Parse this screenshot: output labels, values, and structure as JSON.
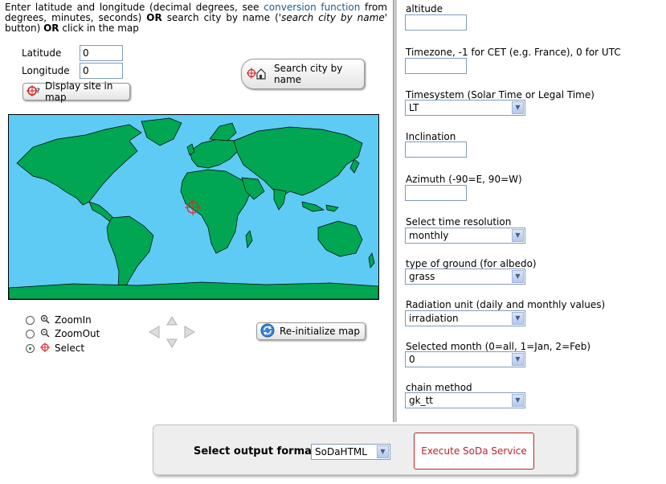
{
  "intro": {
    "part1": "Enter latitude and longitude (decimal degrees, see ",
    "link": "conversion function",
    "part2": " from degrees, minutes, seconds) ",
    "or1": "OR",
    "part3": " search city by name (",
    "italic": "'search city by name'",
    "part4": " button) ",
    "or2": "OR",
    "part5": " click in the map"
  },
  "coords": {
    "latitude_label": "Latitude",
    "latitude_value": "0",
    "longitude_label": "Longitude",
    "longitude_value": "0"
  },
  "buttons": {
    "display_site": "Display site in map",
    "search_city": "Search city by name",
    "reinit_map": "Re-initialize map"
  },
  "map_tools": [
    {
      "label": "ZoomIn",
      "selected": false,
      "icon": "zoom-in-icon"
    },
    {
      "label": "ZoomOut",
      "selected": false,
      "icon": "zoom-out-icon"
    },
    {
      "label": "Select",
      "selected": true,
      "icon": "crosshair-icon"
    }
  ],
  "form": {
    "altitude_label": "altitude",
    "altitude_value": "",
    "timezone_label": "Timezone, -1 for CET (e.g. France), 0 for UTC",
    "timezone_value": "",
    "timesystem_label": "Timesystem (Solar Time or Legal Time)",
    "timesystem_value": "LT",
    "inclination_label": "Inclination",
    "inclination_value": "",
    "azimuth_label": "Azimuth (-90=E, 90=W)",
    "azimuth_value": "",
    "time_resolution_label": "Select time resolution",
    "time_resolution_value": "monthly",
    "ground_label": "type of ground (for albedo)",
    "ground_value": "grass",
    "radiation_unit_label": "Radiation unit (daily and monthly values)",
    "radiation_unit_value": "irradiation",
    "month_label": "Selected month (0=all, 1=Jan, 2=Feb)",
    "month_value": "0",
    "chain_label": "chain method",
    "chain_value": "gk_tt"
  },
  "output": {
    "format_label": "Select output format :",
    "format_value": "SoDaHTML",
    "execute_label": "Execute SoDa Service"
  },
  "colors": {
    "ocean": "#5ecbf5",
    "land": "#00a651",
    "marker": "#e0282a",
    "execute_text": "#c0202a"
  }
}
